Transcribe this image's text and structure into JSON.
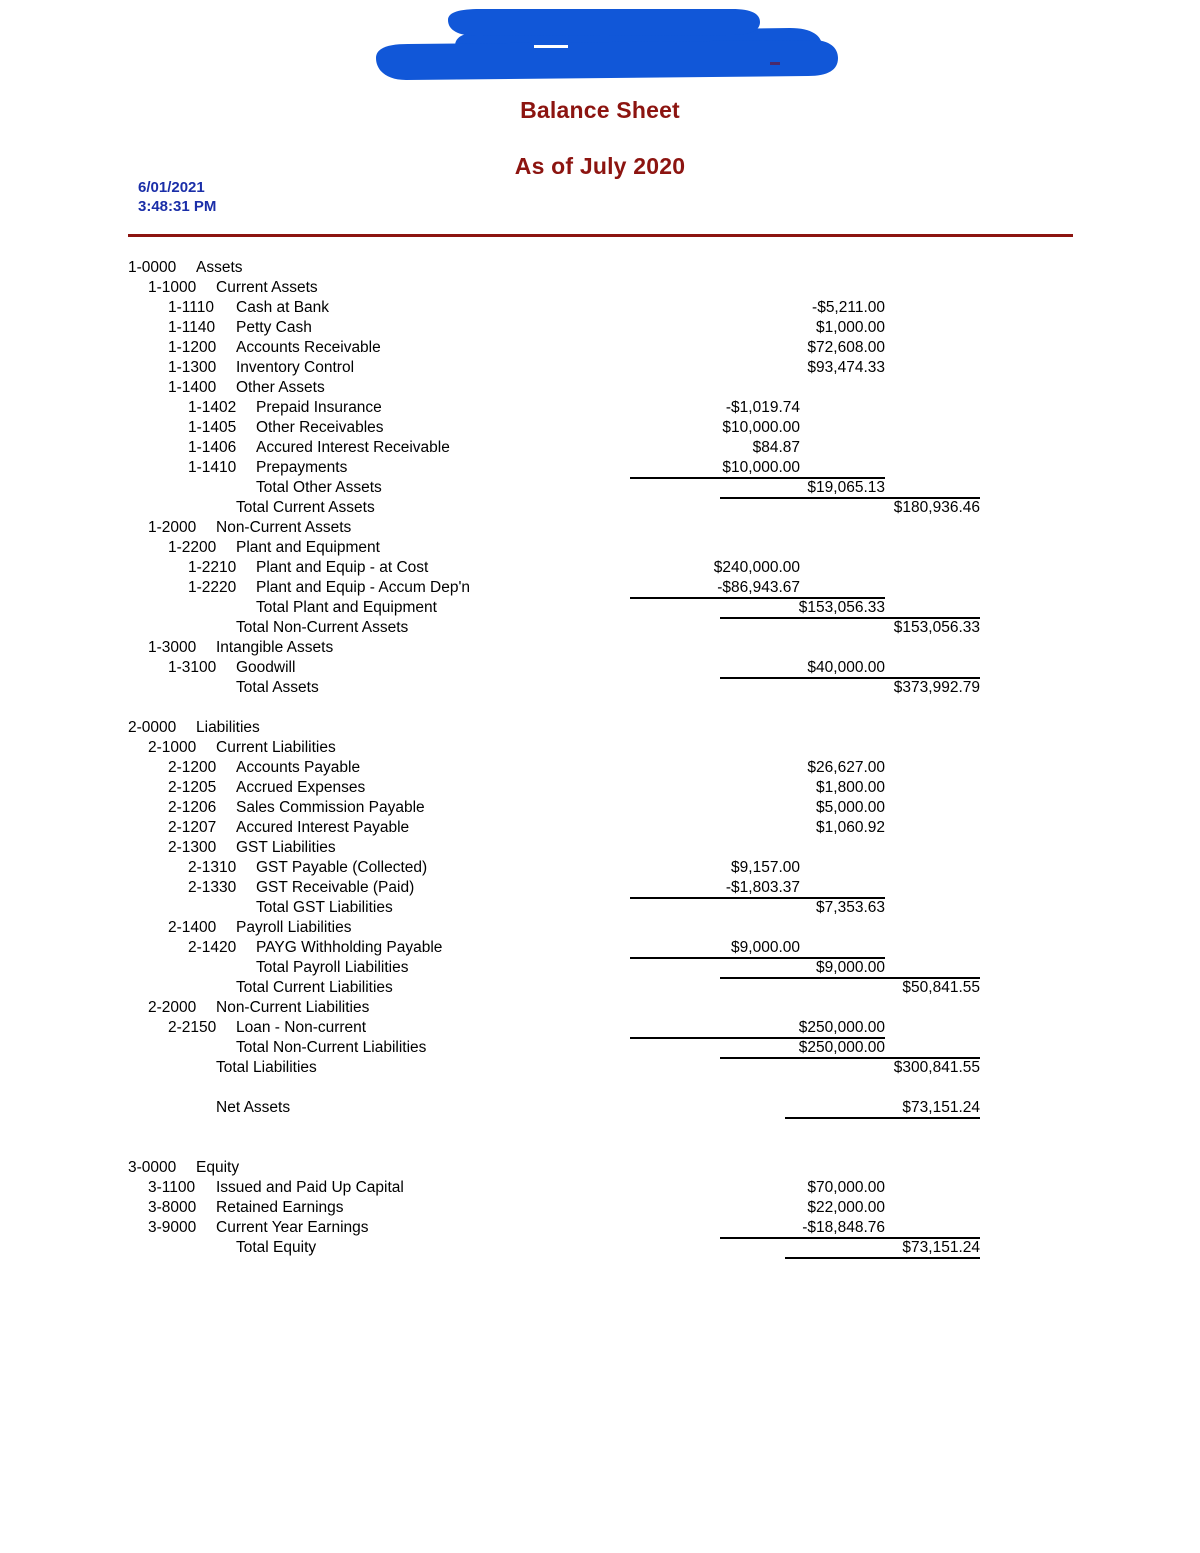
{
  "header": {
    "company_name_redacted": true,
    "redaction_color": "#1157d8",
    "title": "Balance Sheet",
    "subtitle": "As of July 2020",
    "print_date": "6/01/2021",
    "print_time": "3:48:31 PM",
    "title_color": "#8c1410",
    "stamp_color": "#1a2ea8",
    "rule_color": "#8c1410"
  },
  "rows": [
    {
      "code": "1-0000",
      "label": "Assets",
      "indent": 0,
      "nameIndent": 0
    },
    {
      "code": "1-1000",
      "label": "Current Assets",
      "indent": 1,
      "nameIndent": 1
    },
    {
      "code": "1-1110",
      "label": "Cash at Bank",
      "indent": 2,
      "nameIndent": 2,
      "amount": "-$5,211.00",
      "col": 3
    },
    {
      "code": "1-1140",
      "label": "Petty Cash",
      "indent": 2,
      "nameIndent": 2,
      "amount": "$1,000.00",
      "col": 3
    },
    {
      "code": "1-1200",
      "label": "Accounts Receivable",
      "indent": 2,
      "nameIndent": 2,
      "amount": "$72,608.00",
      "col": 3
    },
    {
      "code": "1-1300",
      "label": "Inventory Control",
      "indent": 2,
      "nameIndent": 2,
      "amount": "$93,474.33",
      "col": 3
    },
    {
      "code": "1-1400",
      "label": "Other Assets",
      "indent": 2,
      "nameIndent": 2
    },
    {
      "code": "1-1402",
      "label": "Prepaid Insurance",
      "indent": 3,
      "nameIndent": 3,
      "amount": "-$1,019.74",
      "col": 2
    },
    {
      "code": "1-1405",
      "label": "Other Receivables",
      "indent": 3,
      "nameIndent": 3,
      "amount": "$10,000.00",
      "col": 2
    },
    {
      "code": "1-1406",
      "label": "Accured Interest Receivable",
      "indent": 3,
      "nameIndent": 3,
      "amount": "$84.87",
      "col": 2
    },
    {
      "code": "1-1410",
      "label": "Prepayments",
      "indent": 3,
      "nameIndent": 3,
      "amount": "$10,000.00",
      "col": 2
    },
    {
      "code": "",
      "label": "Total Other Assets",
      "indent": 0,
      "nameIndent": 3,
      "amount": "$19,065.13",
      "col": 3,
      "ruleTop": true,
      "ruleWidth": 255,
      "ruleRight": 315
    },
    {
      "code": "",
      "label": "Total Current Assets",
      "indent": 0,
      "nameIndent": 2,
      "amount": "$180,936.46",
      "col": 4,
      "ruleTop": true,
      "ruleWidth": 260,
      "ruleRight": 220
    },
    {
      "code": "1-2000",
      "label": "Non-Current Assets",
      "indent": 1,
      "nameIndent": 1
    },
    {
      "code": "1-2200",
      "label": "Plant and Equipment",
      "indent": 2,
      "nameIndent": 2
    },
    {
      "code": "1-2210",
      "label": "Plant and Equip - at Cost",
      "indent": 3,
      "nameIndent": 3,
      "amount": "$240,000.00",
      "col": 2
    },
    {
      "code": "1-2220",
      "label": "Plant and Equip - Accum Dep'n",
      "indent": 3,
      "nameIndent": 3,
      "amount": "-$86,943.67",
      "col": 2
    },
    {
      "code": "",
      "label": "Total Plant and Equipment",
      "indent": 0,
      "nameIndent": 3,
      "amount": "$153,056.33",
      "col": 3,
      "ruleTop": true,
      "ruleWidth": 255,
      "ruleRight": 315
    },
    {
      "code": "",
      "label": "Total Non-Current Assets",
      "indent": 0,
      "nameIndent": 2,
      "amount": "$153,056.33",
      "col": 4,
      "ruleTop": true,
      "ruleWidth": 260,
      "ruleRight": 220
    },
    {
      "code": "1-3000",
      "label": "Intangible Assets",
      "indent": 1,
      "nameIndent": 1
    },
    {
      "code": "1-3100",
      "label": "Goodwill",
      "indent": 2,
      "nameIndent": 2,
      "amount": "$40,000.00",
      "col": 3
    },
    {
      "code": "",
      "label": "Total Assets",
      "indent": 0,
      "nameIndent": 2,
      "amount": "$373,992.79",
      "col": 4,
      "ruleTop": true,
      "ruleWidth": 260,
      "ruleRight": 220
    },
    {
      "spacer": true
    },
    {
      "code": "2-0000",
      "label": "Liabilities",
      "indent": 0,
      "nameIndent": 0
    },
    {
      "code": "2-1000",
      "label": "Current Liabilities",
      "indent": 1,
      "nameIndent": 1
    },
    {
      "code": "2-1200",
      "label": "Accounts Payable",
      "indent": 2,
      "nameIndent": 2,
      "amount": "$26,627.00",
      "col": 3
    },
    {
      "code": "2-1205",
      "label": "Accrued Expenses",
      "indent": 2,
      "nameIndent": 2,
      "amount": "$1,800.00",
      "col": 3
    },
    {
      "code": "2-1206",
      "label": "Sales Commission Payable",
      "indent": 2,
      "nameIndent": 2,
      "amount": "$5,000.00",
      "col": 3
    },
    {
      "code": "2-1207",
      "label": "Accured Interest Payable",
      "indent": 2,
      "nameIndent": 2,
      "amount": "$1,060.92",
      "col": 3
    },
    {
      "code": "2-1300",
      "label": "GST Liabilities",
      "indent": 2,
      "nameIndent": 2
    },
    {
      "code": "2-1310",
      "label": "GST Payable (Collected)",
      "indent": 3,
      "nameIndent": 3,
      "amount": "$9,157.00",
      "col": 2
    },
    {
      "code": "2-1330",
      "label": "GST Receivable (Paid)",
      "indent": 3,
      "nameIndent": 3,
      "amount": "-$1,803.37",
      "col": 2
    },
    {
      "code": "",
      "label": "Total GST Liabilities",
      "indent": 0,
      "nameIndent": 3,
      "amount": "$7,353.63",
      "col": 3,
      "ruleTop": true,
      "ruleWidth": 255,
      "ruleRight": 315
    },
    {
      "code": "2-1400",
      "label": "Payroll Liabilities",
      "indent": 2,
      "nameIndent": 2
    },
    {
      "code": "2-1420",
      "label": "PAYG Withholding Payable",
      "indent": 3,
      "nameIndent": 3,
      "amount": "$9,000.00",
      "col": 2
    },
    {
      "code": "",
      "label": "Total Payroll Liabilities",
      "indent": 0,
      "nameIndent": 3,
      "amount": "$9,000.00",
      "col": 3,
      "ruleTop": true,
      "ruleWidth": 255,
      "ruleRight": 315
    },
    {
      "code": "",
      "label": "Total Current Liabilities",
      "indent": 0,
      "nameIndent": 2,
      "amount": "$50,841.55",
      "col": 4,
      "ruleTop": true,
      "ruleWidth": 260,
      "ruleRight": 220
    },
    {
      "code": "2-2000",
      "label": "Non-Current Liabilities",
      "indent": 1,
      "nameIndent": 1
    },
    {
      "code": "2-2150",
      "label": "Loan - Non-current",
      "indent": 2,
      "nameIndent": 2,
      "amount": "$250,000.00",
      "col": 3
    },
    {
      "code": "",
      "label": "Total Non-Current Liabilities",
      "indent": 0,
      "nameIndent": 2,
      "amount": "$250,000.00",
      "col": 3,
      "ruleTop": true,
      "ruleWidth": 255,
      "ruleRight": 315
    },
    {
      "code": "",
      "label": "Total Liabilities",
      "indent": 0,
      "nameIndent": 1,
      "amount": "$300,841.55",
      "col": 4,
      "ruleTop": true,
      "ruleWidth": 260,
      "ruleRight": 220
    },
    {
      "spacer": true
    },
    {
      "code": "",
      "label": "Net Assets",
      "indent": 0,
      "nameIndent": 1,
      "amount": "$73,151.24",
      "col": 4,
      "ruleBottom": true,
      "ruleWidth": 195,
      "ruleRight": 220
    },
    {
      "spacer": true
    },
    {
      "spacer": true
    },
    {
      "code": "3-0000",
      "label": "Equity",
      "indent": 0,
      "nameIndent": 0
    },
    {
      "code": "3-1100",
      "label": "Issued and Paid Up Capital",
      "indent": 1,
      "nameIndent": 1,
      "amount": "$70,000.00",
      "col": 3
    },
    {
      "code": "3-8000",
      "label": "Retained Earnings",
      "indent": 1,
      "nameIndent": 1,
      "amount": "$22,000.00",
      "col": 3
    },
    {
      "code": "3-9000",
      "label": "Current Year Earnings",
      "indent": 1,
      "nameIndent": 1,
      "amount": "-$18,848.76",
      "col": 3
    },
    {
      "code": "",
      "label": "Total Equity",
      "indent": 0,
      "nameIndent": 2,
      "amount": "$73,151.24",
      "col": 4,
      "ruleTop": true,
      "ruleBottom": true,
      "ruleWidth": 260,
      "ruleRight": 220,
      "ruleBottomWidth": 195
    }
  ]
}
